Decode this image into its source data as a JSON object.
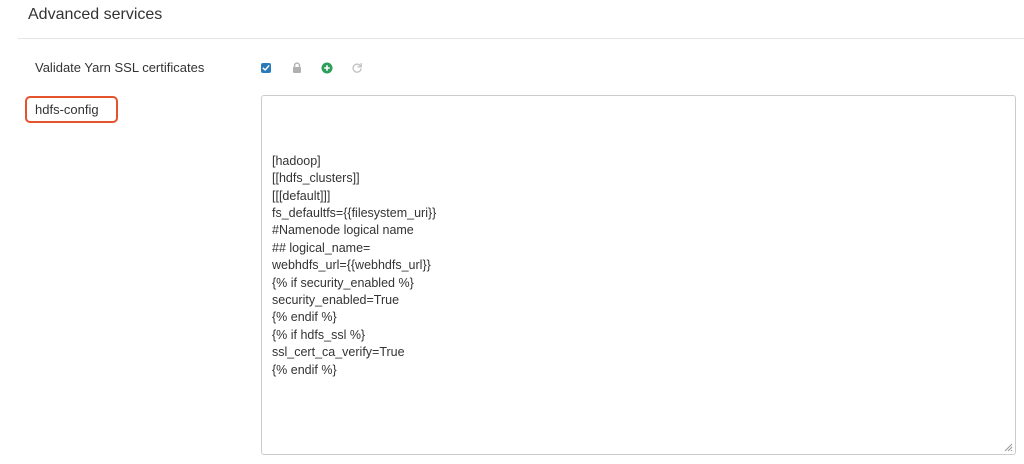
{
  "section": {
    "title": "Advanced services"
  },
  "ssl_row": {
    "label": "Validate Yarn SSL certificates",
    "checked": true,
    "icons": [
      "checkbox-checked-icon",
      "lock-icon",
      "plus-circle-icon",
      "undo-icon"
    ],
    "colors": {
      "checkbox": "#2a7ab9",
      "lock": "#b0b0b0",
      "add": "#2e9e5b",
      "undo": "#c4c4c4"
    }
  },
  "hdfs_row": {
    "label": "hdfs-config",
    "highlight_color": "#e5532d",
    "value_lines": [
      "[hadoop]",
      "[[hdfs_clusters]]",
      "[[[default]]]",
      "fs_defaultfs={{filesystem_uri}}",
      "#Namenode logical name",
      "## logical_name=",
      "webhdfs_url={{webhdfs_url}}",
      "{% if security_enabled %}",
      "security_enabled=True",
      "{% endif %}",
      "{% if hdfs_ssl %}",
      "ssl_cert_ca_verify=True",
      "{% endif %}"
    ]
  }
}
